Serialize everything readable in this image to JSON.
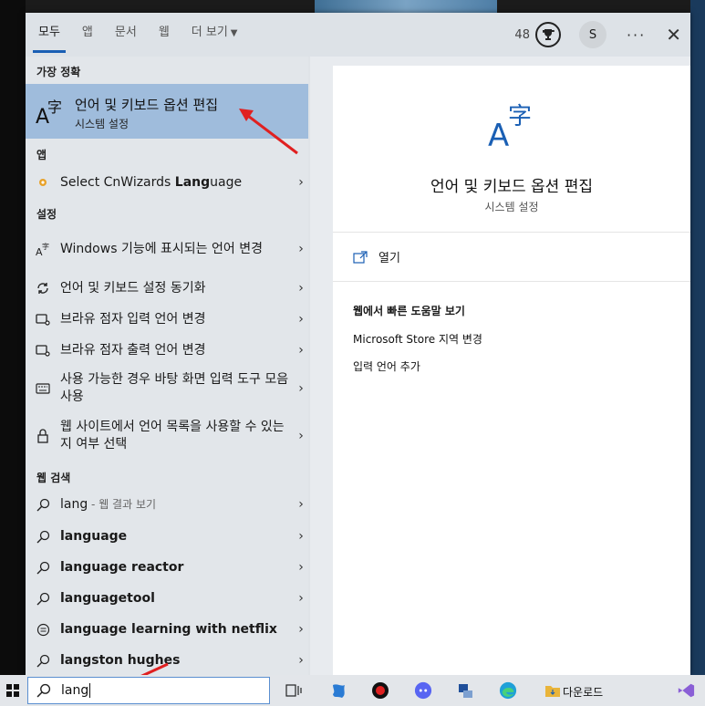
{
  "tabs": [
    {
      "label": "모두",
      "active": true
    },
    {
      "label": "앱",
      "active": false
    },
    {
      "label": "문서",
      "active": false
    },
    {
      "label": "웹",
      "active": false
    },
    {
      "label": "더 보기",
      "active": false
    }
  ],
  "header": {
    "points": "48",
    "avatar": "S",
    "ellipsis": "···",
    "close": "✕"
  },
  "sections": {
    "best_match": "가장 정확",
    "apps": "앱",
    "settings": "설정",
    "web_search": "웹 검색"
  },
  "best_match": {
    "title": "언어 및 키보드 옵션 편집",
    "subtitle": "시스템 설정",
    "icon": "language-a-icon"
  },
  "apps": [
    {
      "prefix": "Select CnWizards ",
      "bold": "Lang",
      "suffix": "uage",
      "icon": "cnwizards-icon"
    }
  ],
  "settings": [
    {
      "label": "Windows 기능에 표시되는 언어 변경",
      "icon": "language-a-icon"
    },
    {
      "label": "언어 및 키보드 설정 동기화",
      "icon": "sync-icon"
    },
    {
      "label": "브라유 점자 입력 언어 변경",
      "icon": "braille-icon"
    },
    {
      "label": "브라유 점자 출력 언어 변경",
      "icon": "braille-icon"
    },
    {
      "label": "사용 가능한 경우 바탕 화면 입력 도구 모음 사용",
      "icon": "keyboard-icon"
    },
    {
      "label": "웹 사이트에서 언어 목록을 사용할 수 있는지 여부 선택",
      "icon": "lock-icon"
    }
  ],
  "web_search": [
    {
      "query": "lang",
      "hint": " - 웹 결과 보기",
      "icon": "search-icon"
    },
    {
      "query": "language",
      "hint": "",
      "icon": "search-icon"
    },
    {
      "query": "language reactor",
      "hint": "",
      "icon": "search-icon"
    },
    {
      "query": "languagetool",
      "hint": "",
      "icon": "search-icon"
    },
    {
      "query": "language learning with netflix",
      "hint": "",
      "icon": "store-icon"
    },
    {
      "query": "langston hughes",
      "hint": "",
      "icon": "search-icon"
    }
  ],
  "preview": {
    "title": "언어 및 키보드 옵션 편집",
    "subtitle": "시스템 설정",
    "open_label": "열기",
    "web_header": "웹에서 빠른 도움말 보기",
    "web_links": [
      "Microsoft Store 지역 변경",
      "입력 언어 추가"
    ]
  },
  "taskbar": {
    "search_value": "lang",
    "downloads_label": "다운로드"
  },
  "colors": {
    "accent": "#1a5fb4",
    "best_match_bg": "#9fbcdc",
    "arrow": "#e02020"
  }
}
